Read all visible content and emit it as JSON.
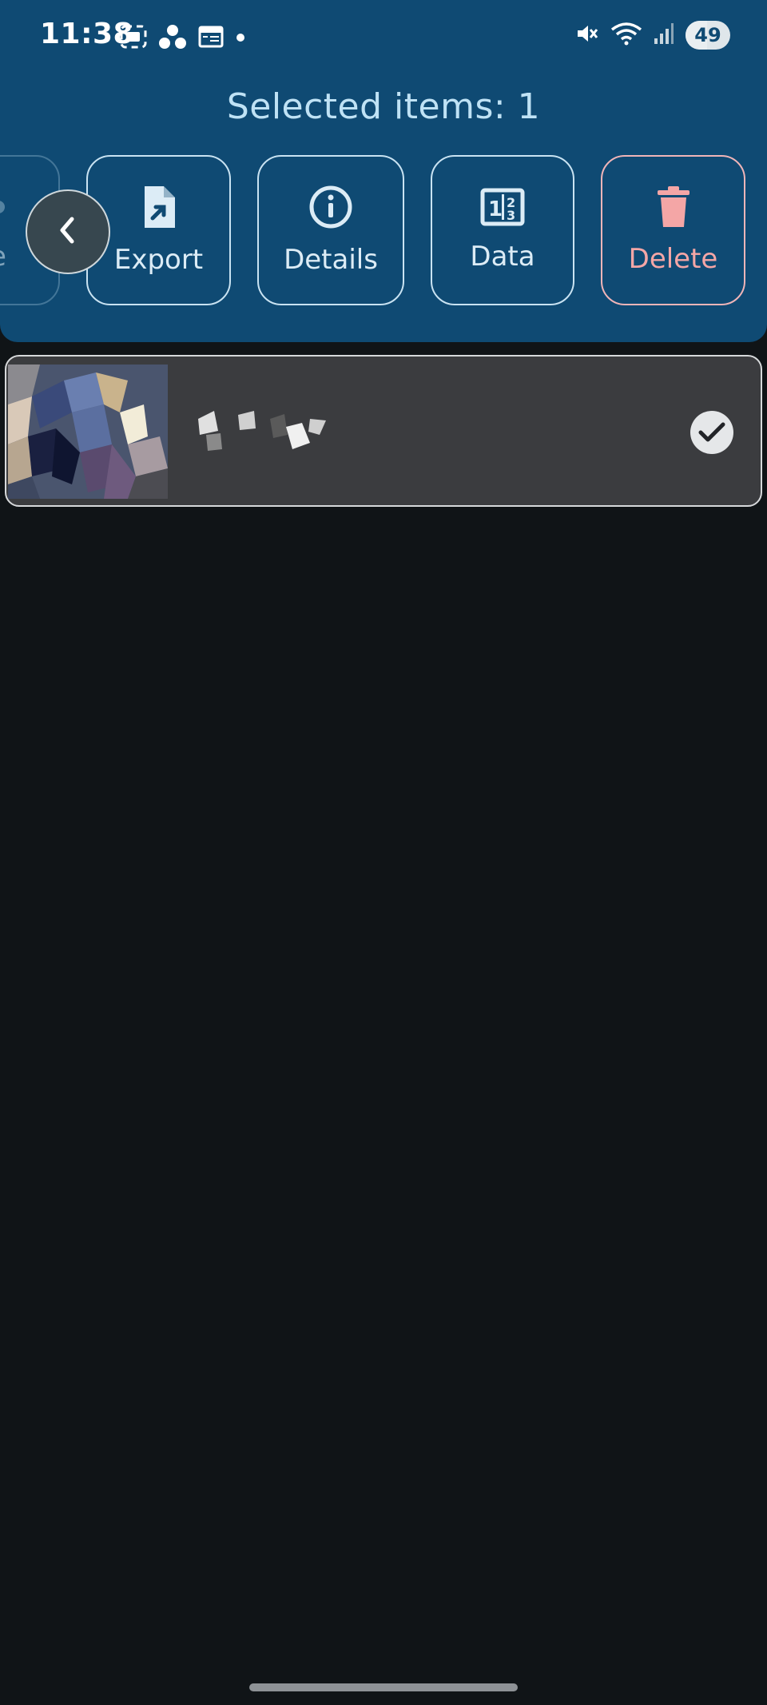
{
  "status_bar": {
    "time": "11:38",
    "battery": "49",
    "battery_level_percent": 49,
    "left_icons": [
      "screenshot-icon",
      "people-icon",
      "calendar-icon",
      "dot-icon"
    ],
    "right_icons": [
      "mute-icon",
      "wifi-icon",
      "signal-icon",
      "battery-icon"
    ]
  },
  "header": {
    "title": "Selected items: 1"
  },
  "actions": [
    {
      "id": "partial",
      "label": "e",
      "icon": "share-icon"
    },
    {
      "id": "export",
      "label": "Export",
      "icon": "file-export-icon"
    },
    {
      "id": "details",
      "label": "Details",
      "icon": "info-icon"
    },
    {
      "id": "data",
      "label": "Data",
      "icon": "numbers-icon"
    },
    {
      "id": "delete",
      "label": "Delete",
      "icon": "trash-icon"
    }
  ],
  "list": {
    "items": [
      {
        "selected": true,
        "thumbnail": "pixelated-thumbnail",
        "title_hidden": true
      }
    ]
  },
  "colors": {
    "panel": "#0f4a73",
    "background": "#101417",
    "item_bg": "#3b3c3f",
    "accent_text": "#bfe2f5",
    "delete": "#f4a6a6"
  }
}
